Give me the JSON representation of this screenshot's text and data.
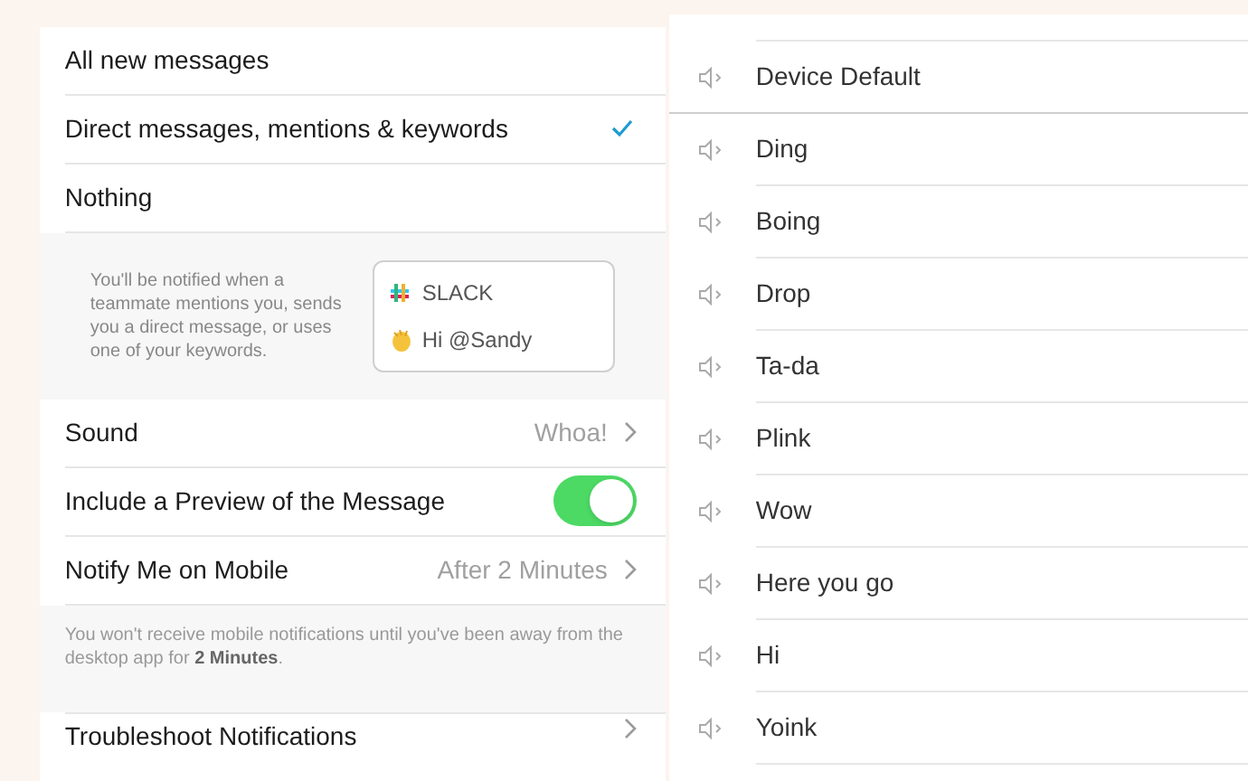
{
  "notify_options": [
    {
      "label": "All new messages",
      "checked": false
    },
    {
      "label": "Direct messages, mentions & keywords",
      "checked": true
    },
    {
      "label": "Nothing",
      "checked": false
    }
  ],
  "info": {
    "text": "You'll be notified when a teammate mentions you, sends you a direct message, or uses one of your keywords.",
    "preview_app": "SLACK",
    "preview_message": "Hi @Sandy"
  },
  "settings": [
    {
      "kind": "link",
      "label": "Sound",
      "value": "Whoa!"
    },
    {
      "kind": "toggle",
      "label": "Include a Preview of the Message",
      "on": true
    },
    {
      "kind": "link",
      "label": "Notify Me on Mobile",
      "value": "After 2 Minutes"
    }
  ],
  "mobile_note": "You won't receive mobile notifications until you've been away from the desktop app for **2 Minutes**.",
  "troubleshoot": "Troubleshoot Notifications",
  "sounds": [
    "Device Default",
    "Ding",
    "Boing",
    "Drop",
    "Ta-da",
    "Plink",
    "Wow",
    "Here you go",
    "Hi",
    "Yoink"
  ]
}
